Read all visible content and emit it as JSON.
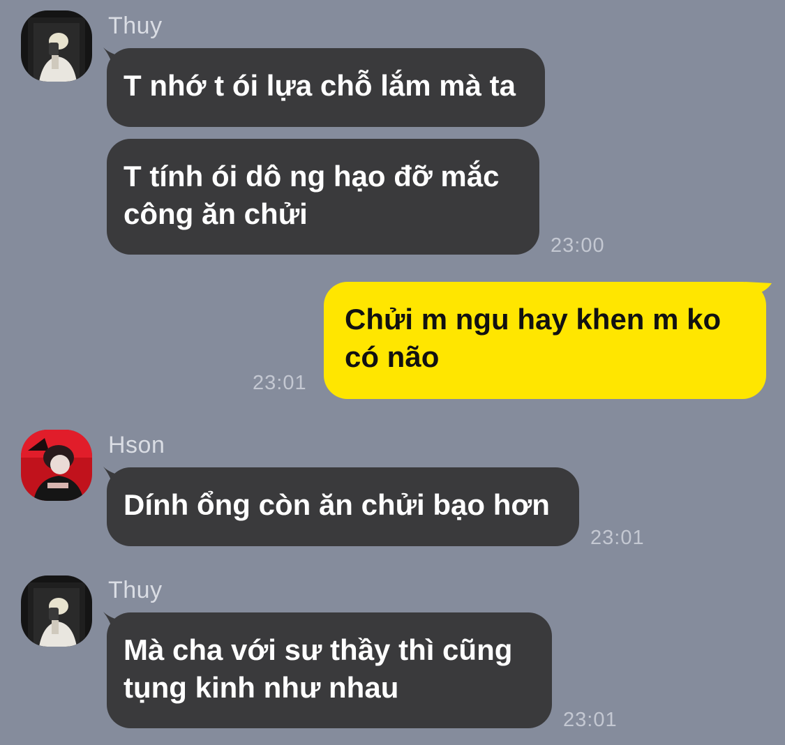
{
  "chat": {
    "messages": [
      {
        "sender": "Thuy",
        "text": "T nhớ t ói lựa chỗ lắm mà ta",
        "time": ""
      },
      {
        "sender": "Thuy",
        "text": "T tính ói dô ng hạo đỡ mắc công ăn chửi",
        "time": "23:00"
      },
      {
        "sender": "me",
        "text": "Chửi m ngu hay khen m ko có não",
        "time": "23:01"
      },
      {
        "sender": "Hson",
        "text": "Dính ổng còn ăn chửi bạo hơn",
        "time": "23:01"
      },
      {
        "sender": "Thuy",
        "text": "Mà cha với sư thầy thì cũng tụng kinh như nhau",
        "time": "23:01"
      }
    ],
    "senders": {
      "thuy": {
        "name": "Thuy",
        "avatar": "avatar-photo-blonde"
      },
      "hson": {
        "name": "Hson",
        "avatar": "avatar-photo-red"
      }
    },
    "colors": {
      "background": "#858c9c",
      "incoming_bubble": "#3a3a3c",
      "outgoing_bubble": "#ffe600",
      "timestamp": "#c4c8d2",
      "sender_name": "#dadde4"
    }
  }
}
